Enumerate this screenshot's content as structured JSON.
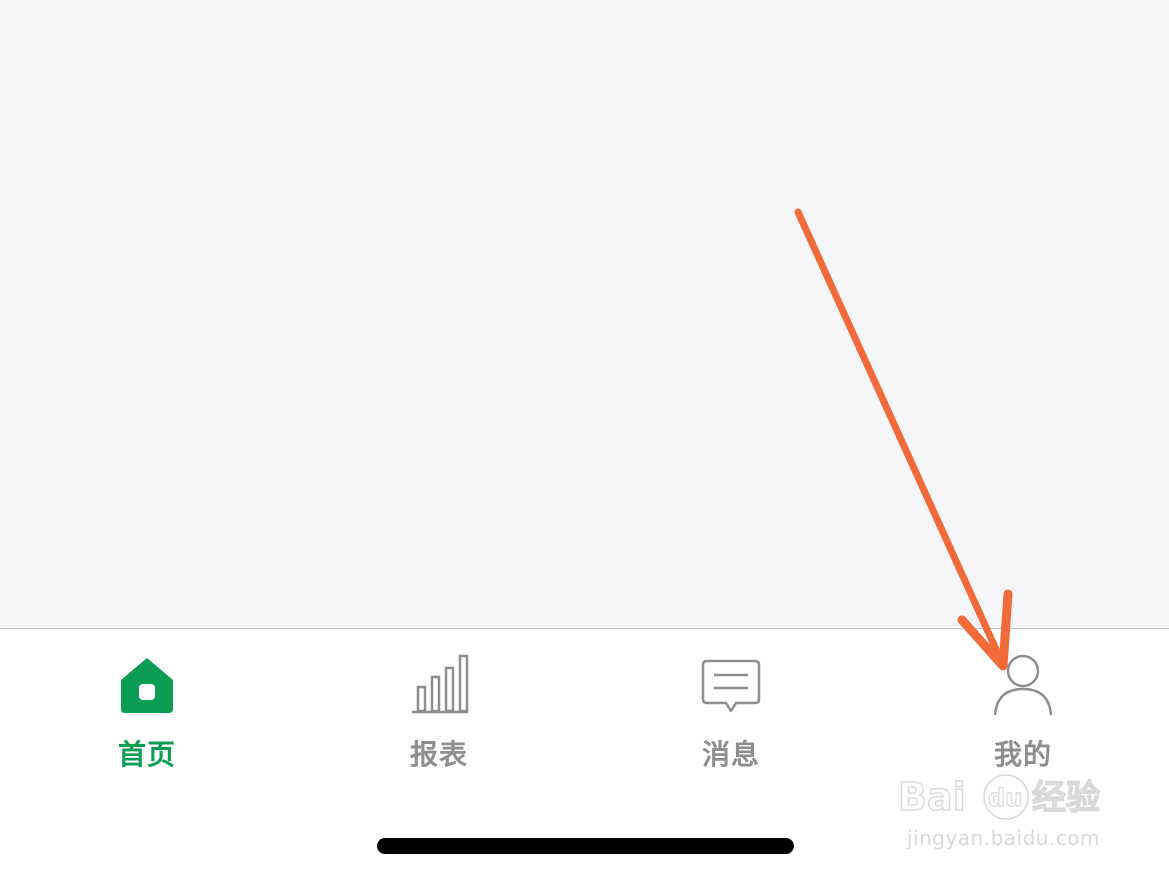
{
  "tabbar": {
    "active_color": "#0b9e53",
    "inactive_color": "#8e8e8e",
    "items": [
      {
        "label": "首页",
        "icon": "home-icon",
        "active": true
      },
      {
        "label": "报表",
        "icon": "bar-chart-icon",
        "active": false
      },
      {
        "label": "消息",
        "icon": "message-icon",
        "active": false
      },
      {
        "label": "我的",
        "icon": "person-icon",
        "active": false
      }
    ]
  },
  "annotation": {
    "icon": "arrow-icon",
    "color": "#f26a3a"
  },
  "watermark": {
    "logo_text": "Baidu 经验",
    "url": "jingyan.baidu.com"
  }
}
